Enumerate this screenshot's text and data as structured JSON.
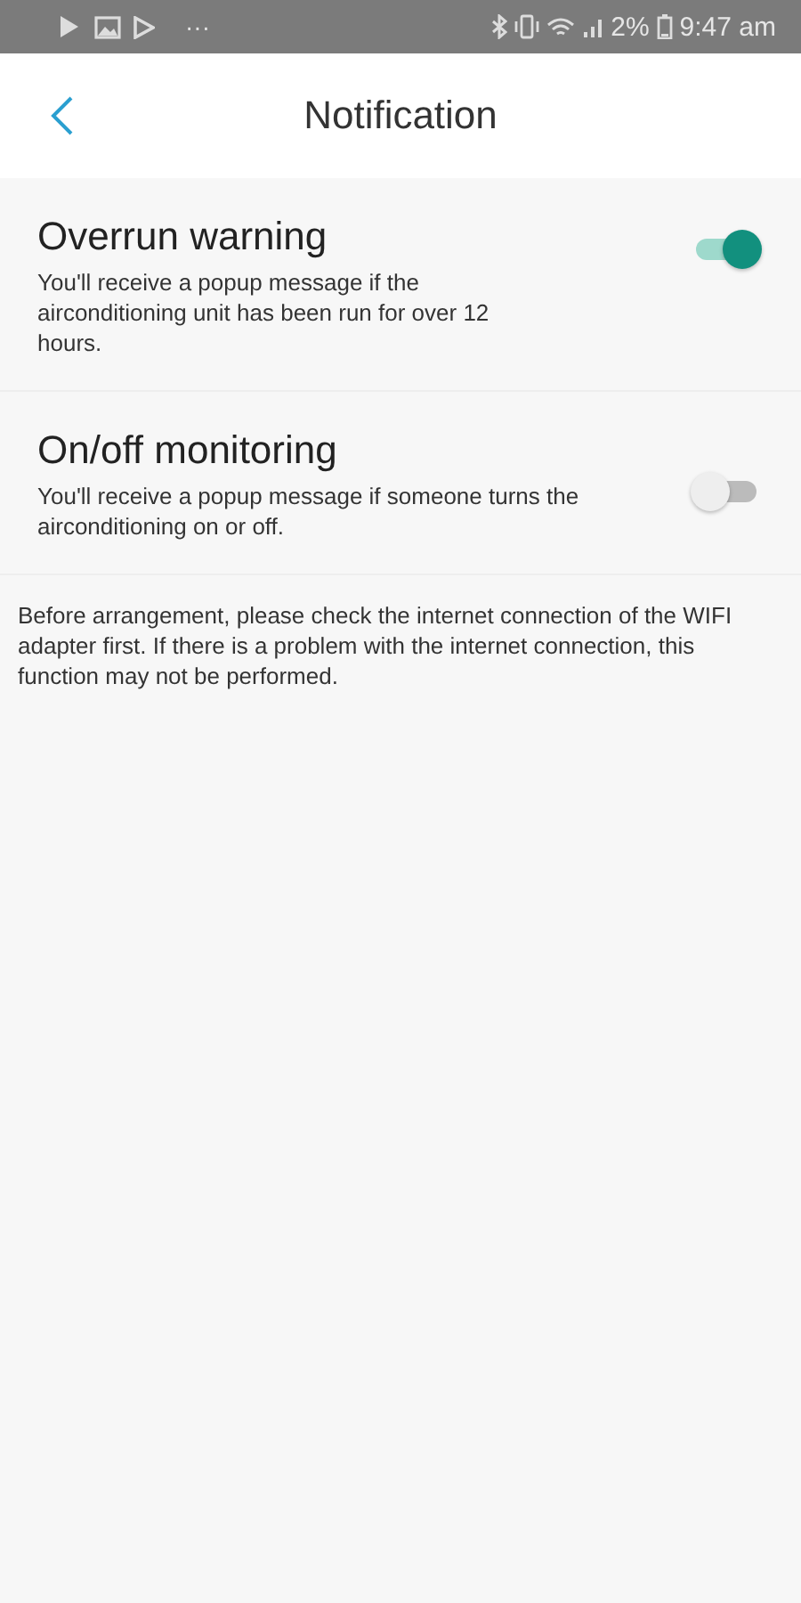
{
  "status_bar": {
    "more": "···",
    "battery": "2%",
    "time": "9:47 am"
  },
  "header": {
    "title": "Notification"
  },
  "settings": [
    {
      "title": "Overrun warning",
      "description": "You'll receive a popup message if the airconditioning unit has been run for over 12 hours.",
      "on": true
    },
    {
      "title": "On/off monitoring",
      "description": "You'll receive a popup message if someone turns the airconditioning on or off.",
      "on": false
    }
  ],
  "note": "Before arrangement, please check the internet connection of the WIFI adapter first. If there is a problem with the internet connection, this function may not be performed."
}
